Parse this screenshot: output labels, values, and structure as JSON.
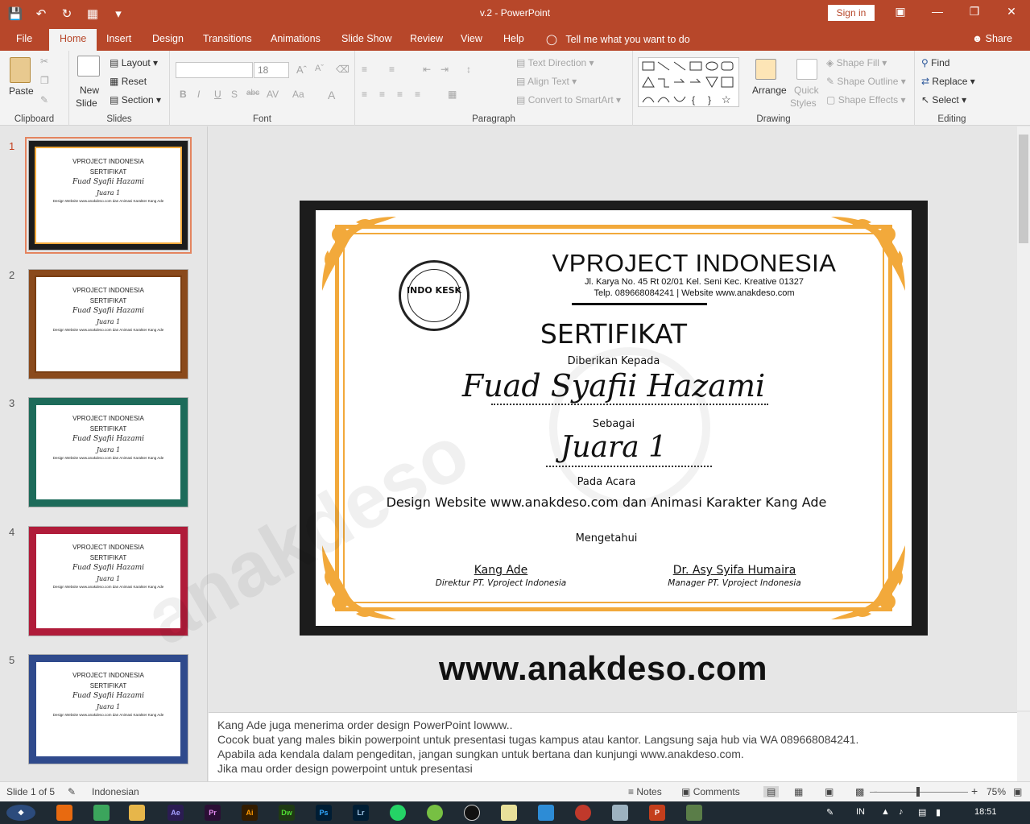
{
  "window": {
    "title": "v.2  -  PowerPoint",
    "signin": "Sign in"
  },
  "tabs": [
    "File",
    "Home",
    "Insert",
    "Design",
    "Transitions",
    "Animations",
    "Slide Show",
    "Review",
    "View",
    "Help"
  ],
  "active_tab": "Home",
  "tell_me": "Tell me what you want to do",
  "share": "Share",
  "ribbon": {
    "clipboard": {
      "label": "Clipboard",
      "paste": "Paste"
    },
    "slides": {
      "label": "Slides",
      "new_slide": "New",
      "new_slide2": "Slide",
      "layout": "Layout",
      "reset": "Reset",
      "section": "Section"
    },
    "font": {
      "label": "Font",
      "size": "18"
    },
    "paragraph": {
      "label": "Paragraph",
      "text_direction": "Text Direction",
      "align_text": "Align Text",
      "convert": "Convert to SmartArt"
    },
    "drawing": {
      "label": "Drawing",
      "arrange": "Arrange",
      "quick_styles": "Quick",
      "quick_styles2": "Styles",
      "shape_fill": "Shape Fill",
      "shape_outline": "Shape Outline",
      "shape_effects": "Shape Effects"
    },
    "editing": {
      "label": "Editing",
      "find": "Find",
      "replace": "Replace",
      "select": "Select"
    }
  },
  "thumbnails": [
    {
      "num": "1",
      "color": "#f2a93b",
      "border": "#1c1c1c"
    },
    {
      "num": "2",
      "color": "#7a3e12",
      "border": "#8a4a1c"
    },
    {
      "num": "3",
      "color": "#1d6b5a",
      "border": "#1d6b5a"
    },
    {
      "num": "4",
      "color": "#b01c3a",
      "border": "#b01c3a"
    },
    {
      "num": "5",
      "color": "#2f4a8c",
      "border": "#2f4a8c"
    }
  ],
  "thumb_text": {
    "org": "VPROJECT INDONESIA",
    "cert": "SERTIFIKAT",
    "name": "Fuad Syafii Hazami",
    "rank": "Juara 1",
    "event": "Design Website www.anakdeso.com dan Animasi Karakter Kang Ade"
  },
  "slide": {
    "org": "VPROJECT INDONESIA",
    "address": "Jl. Karya No. 45 Rt 02/01 Kel. Seni Kec. Kreative 01327",
    "contact": "Telp. 089668084241 | Website www.anakdeso.com",
    "logo_text": "INDO KESK",
    "title": "SERTIFIKAT",
    "given_to": "Diberikan Kepada",
    "name": "Fuad Syafii Hazami",
    "as": "Sebagai",
    "rank": "Juara 1",
    "at": "Pada Acara",
    "event": "Design Website www.anakdeso.com dan Animasi Karakter Kang Ade",
    "acknowledged": "Mengetahui",
    "sign1_name": "Kang Ade",
    "sign1_title": "Direktur PT. Vproject Indonesia",
    "sign2_name": "Dr. Asy Syifa Humaira",
    "sign2_title": "Manager PT. Vproject Indonesia"
  },
  "watermark": "anakdeso",
  "site_banner": "www.anakdeso.com",
  "notes": [
    "Kang Ade juga menerima order design PowerPoint lowww..",
    "Cocok buat yang males bikin powerpoint untuk presentasi tugas kampus atau kantor. Langsung saja hub via WA 089668084241.",
    "Apabila ada kendala dalam pengeditan, jangan sungkan untuk bertana dan kunjungi www.anakdeso.com.",
    "Jika mau order design powerpoint untuk presentasi"
  ],
  "status": {
    "slide_info": "Slide 1 of 5",
    "language": "Indonesian",
    "notes": "Notes",
    "comments": "Comments",
    "zoom": "75%"
  },
  "taskbar": {
    "lang": "IN",
    "time": "18:51"
  }
}
